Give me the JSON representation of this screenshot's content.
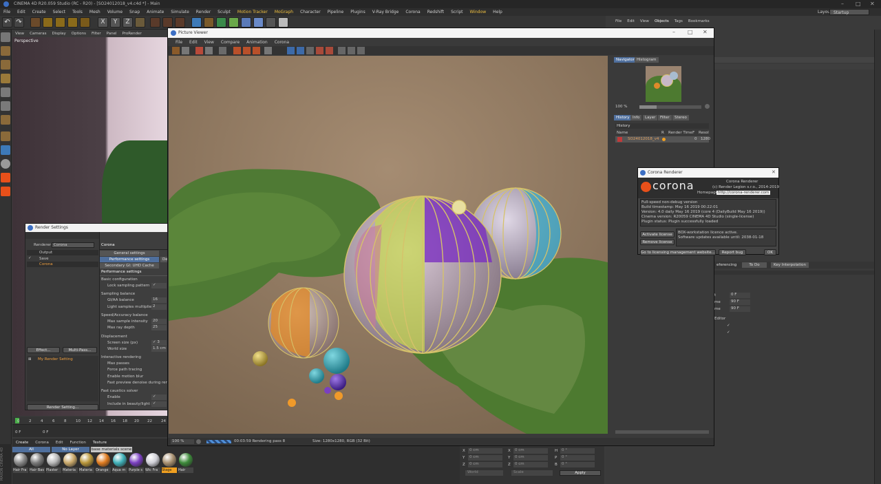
{
  "app": {
    "title": "CINEMA 4D R20.059 Studio (RC - R20) - [SO24012018_v4.c4d *] - Main",
    "layout_label": "Layout:",
    "layout_value": "Startup"
  },
  "menu": [
    "File",
    "Edit",
    "Create",
    "Select",
    "Tools",
    "Mesh",
    "Volume",
    "Snap",
    "Animate",
    "Simulate",
    "Render",
    "Sculpt",
    "Motion Tracker",
    "MoGraph",
    "Character",
    "Pipeline",
    "Plugins",
    "V-Ray Bridge",
    "Corona",
    "Redshift",
    "Script",
    "Window",
    "Help"
  ],
  "viewport": {
    "menu": [
      "View",
      "Cameras",
      "Display",
      "Options",
      "Filter",
      "Panel",
      "ProRender"
    ],
    "label": "Perspective"
  },
  "timeline": {
    "ticks": [
      "0",
      "2",
      "4",
      "6",
      "8",
      "10",
      "12",
      "14",
      "16",
      "18",
      "20",
      "22",
      "24"
    ],
    "start": "0 F",
    "end": "0 F"
  },
  "material_manager": {
    "menu": [
      "Create",
      "Corona",
      "Edit",
      "Function",
      "Texture"
    ],
    "filters": [
      "All",
      "No Layer",
      "base materials scene"
    ],
    "materials": [
      {
        "label": "Hair Fra",
        "color": "#8a8a8a"
      },
      {
        "label": "Hair Bas",
        "color": "#7a7a7a"
      },
      {
        "label": "Plaster",
        "color": "#b8b8b8"
      },
      {
        "label": "Materia",
        "color": "#c9a86a"
      },
      {
        "label": "Materia",
        "color": "#b8963a"
      },
      {
        "label": "Orange",
        "color": "#e07c20"
      },
      {
        "label": "Aqua m",
        "color": "#3fb0b8"
      },
      {
        "label": "Purple s",
        "color": "#7a3fc0"
      },
      {
        "label": "Wic Fra",
        "color": "#cfcfd6"
      },
      {
        "label": "Stage",
        "color": "#a89070"
      },
      {
        "label": "Hair",
        "color": "#3d8a3a"
      }
    ]
  },
  "coordinates": {
    "rows": [
      {
        "a": "X",
        "a_val": "0 cm",
        "b": "X",
        "b_val": "0 cm",
        "c": "H",
        "c_val": "0 °"
      },
      {
        "a": "Y",
        "a_val": "0 cm",
        "b": "Y",
        "b_val": "0 cm",
        "c": "P",
        "c_val": "0 °"
      },
      {
        "a": "Z",
        "a_val": "0 cm",
        "b": "Z",
        "b_val": "0 cm",
        "c": "B",
        "c_val": "0 °"
      }
    ],
    "mode1": "World",
    "mode2": "Scale",
    "apply": "Apply"
  },
  "render_settings": {
    "title": "Render Settings",
    "renderer_label": "Renderer",
    "renderer_value": "Corona",
    "tree": [
      "Output",
      "Save",
      "Corona"
    ],
    "effect_btn": "Effect...",
    "multipass_btn": "Multi-Pass...",
    "preset": "My Render Setting",
    "render_setting_btn": "Render Setting...",
    "panel_title": "Corona",
    "tabs": [
      "General settings",
      "Performance settings",
      "Secondary GI: UHD Cache",
      "Dev"
    ],
    "section": "Performance settings",
    "groups": [
      {
        "name": "Basic configuration",
        "items": [
          {
            "label": "Lock sampling pattern",
            "value": "✓"
          }
        ]
      },
      {
        "name": "Sampling balance",
        "items": [
          {
            "label": "GI/AA balance",
            "value": "16"
          },
          {
            "label": "Light samples multiplier",
            "value": "2"
          }
        ]
      },
      {
        "name": "Speed/Accuracy balance",
        "items": [
          {
            "label": "Max sample intensity",
            "value": "20"
          },
          {
            "label": "Max ray depth",
            "value": "25"
          }
        ]
      },
      {
        "name": "Displacement",
        "items": [
          {
            "label": "Screen size (px)",
            "value": "✓  3"
          },
          {
            "label": "World size",
            "value": "1.5 cm"
          }
        ]
      },
      {
        "name": "Interactive rendering",
        "items": [
          {
            "label": "Max passes",
            "value": ""
          },
          {
            "label": "Force path tracing",
            "value": ""
          },
          {
            "label": "Enable motion blur",
            "value": ""
          },
          {
            "label": "Fast preview denoise during rend",
            "value": ""
          }
        ]
      },
      {
        "name": "Fast caustics solver",
        "items": [
          {
            "label": "Enable",
            "value": "✓"
          },
          {
            "label": "Include in beauty/light select",
            "value": "✓"
          }
        ]
      }
    ]
  },
  "picture_viewer": {
    "title": "Picture Viewer",
    "menu": [
      "File",
      "Edit",
      "View",
      "Compare",
      "Animation",
      "Corona"
    ],
    "zoom": "100 %",
    "status": "00:03:59 Rendering pass 8",
    "size": "Size: 1280x1280, RGB (32 Bit)",
    "nav_tabs": [
      "Navigator",
      "Histogram"
    ],
    "nav_zoom": "100 %",
    "hist_tabs": [
      "History",
      "Info",
      "Layer",
      "Filter",
      "Stereo"
    ],
    "history_label": "History",
    "columns": [
      "Name",
      "R",
      "Render Time",
      "F",
      "Resol"
    ],
    "row": {
      "name": "SO24012018_v4",
      "time": "",
      "f": "0",
      "res": "1280"
    }
  },
  "corona_dialog": {
    "title": "Corona Renderer",
    "logo": "corona",
    "product": "Corona Renderer",
    "copyright": "(c) Render Legion s.r.o., 2014-2019",
    "homepage_label": "Homepage:",
    "homepage": "http://corona-renderer.com",
    "info": [
      "Full-speed non-debug version",
      "Build timestamp: May 16 2019 00:22:01",
      "Version: 4.0 daily May 16 2019 (core 4 (DailyBuild May 16 2019))",
      "Cinema version: R20059 CINEMA 4D Studio (single-license)",
      "Plugin status: Plugin successfully loaded"
    ],
    "license_text": [
      "BOX-workstation licence active.",
      "Software updates available until: 2038-01-18"
    ],
    "activate_btn": "Activate license",
    "remove_btn": "Remove license",
    "goto_btn": "Go to licensing management website...",
    "report_btn": "Report bug",
    "ok_btn": "OK"
  },
  "object_manager": {
    "menu": [
      "File",
      "Edit",
      "View",
      "Objects",
      "Tags",
      "Bookmarks"
    ]
  },
  "attributes": {
    "tabs": [
      "eferencing",
      "To Do",
      "Key Interpolation"
    ],
    "values": [
      "0 F",
      "90 F",
      "90 F"
    ],
    "labels": [
      "t",
      "me",
      ""
    ],
    "editor_label": "Editor"
  },
  "colors": {
    "accent": "#f0c040",
    "selection": "#4f6f9d",
    "corona_orange": "#e8501a"
  }
}
